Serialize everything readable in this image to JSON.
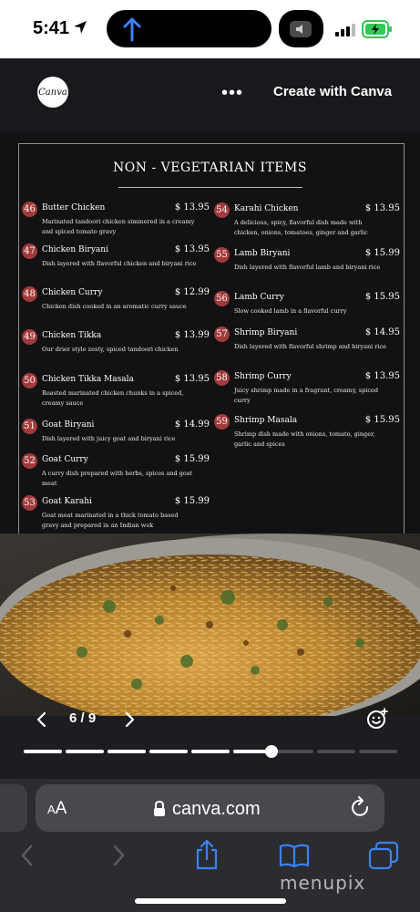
{
  "status_bar": {
    "time": "5:41",
    "icons": [
      "location-arrow-icon",
      "upload-arrow-icon",
      "mute-icon",
      "signal-icon",
      "battery-charging-icon"
    ],
    "battery_color": "#34c759"
  },
  "canva": {
    "logo_text": "Canva",
    "more_icon": "more-dots-icon",
    "create_label": "Create with Canva"
  },
  "menu": {
    "title": "NON - VEGETARIAN ITEMS",
    "accent_color": "#a13a3a",
    "column_left": [
      {
        "num": "46",
        "name": "Butter Chicken",
        "price": "$ 13.95",
        "desc": "Marinated tandoori chicken simmered in a creamy and spiced tomato gravy"
      },
      {
        "num": "47",
        "name": "Chicken Biryani",
        "price": "$ 13.95",
        "desc": "Dish layered with flavorful chicken and biryani rice"
      },
      {
        "num": "48",
        "name": "Chicken Curry",
        "price": "$ 12.99",
        "desc": "Chicken dish cooked in an aromatic curry sauce"
      },
      {
        "num": "49",
        "name": "Chicken Tikka",
        "price": "$ 13.99",
        "desc": "Our drier style zesty, spiced tandoori chicken"
      },
      {
        "num": "50",
        "name": "Chicken Tikka Masala",
        "price": "$ 13.95",
        "desc": "Roasted marinated chicken chunks in a spiced, creamy sauce"
      },
      {
        "num": "51",
        "name": "Goat Biryani",
        "price": "$ 14.99",
        "desc": "Dish layered with juicy goat and biryani rice"
      },
      {
        "num": "52",
        "name": "Goat Curry",
        "price": "$ 15.99",
        "desc": "A curry dish prepared with herbs, spices and goat meat"
      },
      {
        "num": "53",
        "name": "Goat Karahi",
        "price": "$ 15.99",
        "desc": "Goat meat marinated in a thick tomato based gravy and prepared in an Indian wok"
      }
    ],
    "column_right": [
      {
        "num": "54",
        "name": "Karahi Chicken",
        "price": "$ 13.95",
        "desc": "A delicious, spicy, flavorful dish made with chicken, onions, tomatoes, ginger and garlic"
      },
      {
        "num": "55",
        "name": "Lamb Biryani",
        "price": "$ 15.99",
        "desc": "Dish layered with flavorful lamb and biryani rice"
      },
      {
        "num": "56",
        "name": "Lamb Curry",
        "price": "$ 15.95",
        "desc": "Slow cooked lamb in a flavorful curry"
      },
      {
        "num": "57",
        "name": "Shrimp Biryani",
        "price": "$ 14.95",
        "desc": "Dish layered with flavorful shrimp and biryani rice"
      },
      {
        "num": "58",
        "name": "Shrimp Curry",
        "price": "$ 13.95",
        "desc": "Juicy shrimp made in a fragrant, creamy, spiced curry"
      },
      {
        "num": "59",
        "name": "Shrimp Masala",
        "price": "$ 15.95",
        "desc": "Shrimp dish made with onions, tomato, ginger, garlic and spices"
      }
    ],
    "photo": "biryani-photo"
  },
  "pager": {
    "text": "6 / 9",
    "current_page": 6,
    "total_pages": 9,
    "prev_icon": "chevron-left-icon",
    "next_icon": "chevron-right-icon",
    "reaction_icon": "add-reaction-icon"
  },
  "safari": {
    "aa_label": "AA",
    "url": "canva.com",
    "icons": [
      "lock-icon",
      "reload-icon",
      "back-icon",
      "forward-icon",
      "share-icon",
      "bookmarks-icon",
      "tabs-icon"
    ]
  },
  "watermark": "menupix"
}
